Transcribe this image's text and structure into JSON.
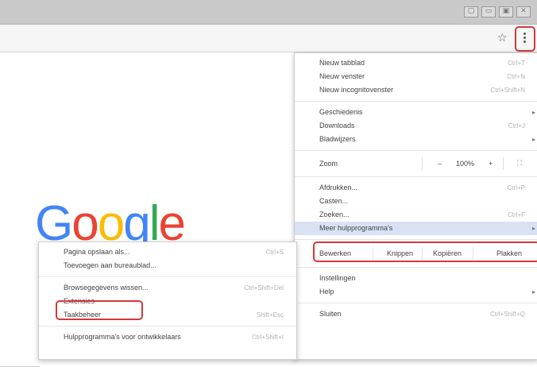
{
  "window": {
    "controls": [
      "▢",
      "▭",
      "▣",
      "✕"
    ]
  },
  "toolbar": {
    "star_icon": "☆",
    "menu_icon": "three-dot-menu"
  },
  "page": {
    "logo": {
      "letters": [
        "G",
        "o",
        "o",
        "g",
        "l",
        "e"
      ],
      "colors": [
        "#4285F4",
        "#EA4335",
        "#FBBC05",
        "#4285F4",
        "#34A853",
        "#EA4335"
      ]
    }
  },
  "main_menu": {
    "items": [
      {
        "label": "Nieuw tabblad",
        "shortcut": "Ctrl+T"
      },
      {
        "label": "Nieuw venster",
        "shortcut": "Ctrl+N"
      },
      {
        "label": "Nieuw incognitovenster",
        "shortcut": "Ctrl+Shift+N"
      },
      {
        "label": "Geschiedenis",
        "arrow": "▸"
      },
      {
        "label": "Downloads",
        "shortcut": "Ctrl+J"
      },
      {
        "label": "Bladwijzers",
        "arrow": "▸"
      },
      {
        "label": "Afdrukken...",
        "shortcut": "Ctrl+P"
      },
      {
        "label": "Casten..."
      },
      {
        "label": "Zoeken...",
        "shortcut": "Ctrl+F"
      },
      {
        "label": "Meer hulpprogramma's",
        "arrow": "▸"
      },
      {
        "label": "Instellingen"
      },
      {
        "label": "Help",
        "arrow": "▸"
      },
      {
        "label": "Sluiten",
        "shortcut": "Ctrl+Shift+Q"
      }
    ],
    "zoom": {
      "label": "Zoom",
      "minus": "–",
      "value": "100%",
      "plus": "+",
      "fullscreen": "⛶"
    },
    "edit": {
      "label": "Bewerken",
      "cut": "Knippen",
      "copy": "Kopiëren",
      "paste": "Plakken"
    }
  },
  "submenu": {
    "items": [
      {
        "label": "Pagina opslaan als...",
        "shortcut": "Ctrl+S"
      },
      {
        "label": "Toevoegen aan bureaublad..."
      },
      {
        "label": "Browsegegevens wissen...",
        "shortcut": "Ctrl+Shift+Del"
      },
      {
        "label": "Extensies"
      },
      {
        "label": "Taakbeheer",
        "shortcut": "Shift+Esc"
      },
      {
        "label": "Hulpprogramma's voor ontwikkelaars",
        "shortcut": "Ctrl+Shift+I"
      }
    ]
  }
}
